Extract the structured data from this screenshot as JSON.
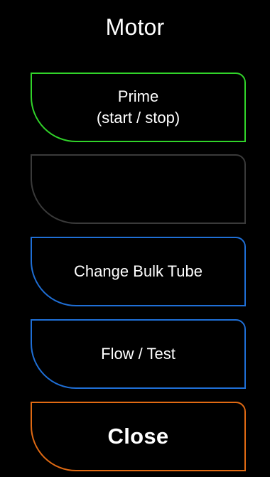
{
  "header": {
    "title": "Motor"
  },
  "buttons": {
    "prime": {
      "label": "Prime\n(start / stop)",
      "border_color": "#31d42a"
    },
    "empty_slot": {
      "label": "",
      "border_color": "#3a3a3a"
    },
    "change_bulk_tube": {
      "label": "Change Bulk Tube",
      "border_color": "#1f6fd6"
    },
    "flow_test": {
      "label": "Flow / Test",
      "border_color": "#1f6fd6"
    },
    "close": {
      "label": "Close",
      "border_color": "#e06a13"
    }
  },
  "theme": {
    "background": "#000000",
    "text": "#ffffff"
  }
}
